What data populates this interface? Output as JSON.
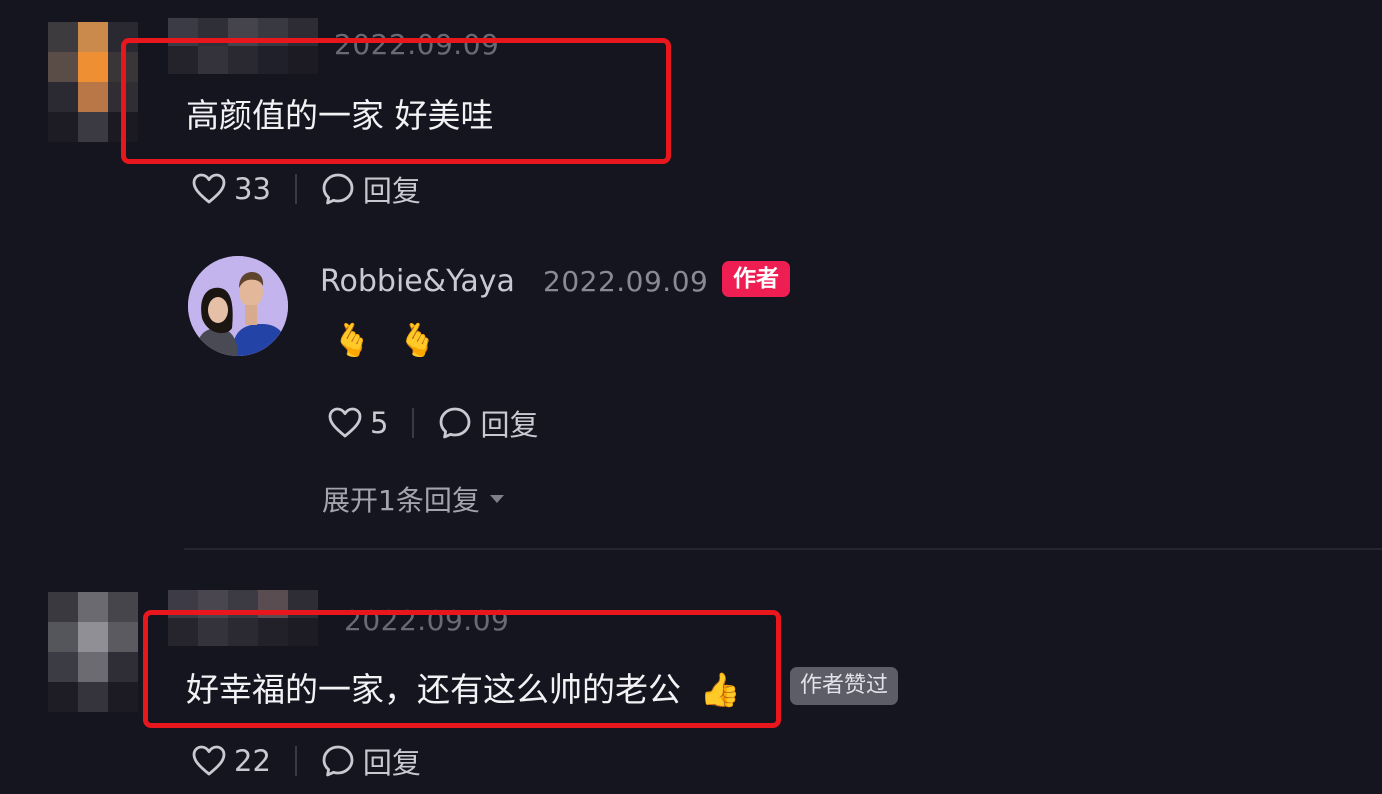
{
  "comments": [
    {
      "date": "2022.09.09",
      "text": "高颜值的一家 好美哇",
      "likes": "33",
      "reply_label": "回复",
      "reply": {
        "author": "Robbie&Yaya",
        "date": "2022.09.09",
        "author_badge": "作者",
        "emojis": [
          "🫰",
          "🫰"
        ],
        "likes": "5",
        "reply_label": "回复",
        "expand_label": "展开1条回复"
      }
    },
    {
      "date": "2022.09.09",
      "text": "好幸福的一家，还有这么帅的老公",
      "emoji": "👍",
      "author_liked_badge": "作者赞过",
      "likes": "22",
      "reply_label": "回复"
    }
  ],
  "icons": {
    "like": "heart-icon",
    "reply": "speech-bubble-icon",
    "expand": "caret-down-icon"
  },
  "colors": {
    "background": "#15151f",
    "highlight": "#e8161d",
    "author_badge": "#ee1d52",
    "liked_badge": "#5d5d68"
  }
}
